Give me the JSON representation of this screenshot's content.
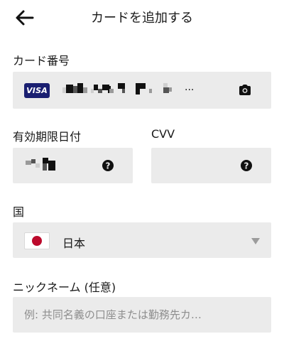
{
  "header": {
    "title": "カードを追加する"
  },
  "card_number": {
    "label": "カード番号",
    "brand": "VISA",
    "ellipsis": "..."
  },
  "expiry": {
    "label": "有効期限日付"
  },
  "cvv": {
    "label": "CVV"
  },
  "country": {
    "label": "国",
    "value": "日本"
  },
  "nickname": {
    "label": "ニックネーム (任意)",
    "placeholder": "例: 共同名義の口座または勤務先カ…"
  },
  "colors": {
    "field_bg": "#ebebeb",
    "visa_blue": "#1a1f71",
    "flag_red": "#bc0a2c"
  }
}
